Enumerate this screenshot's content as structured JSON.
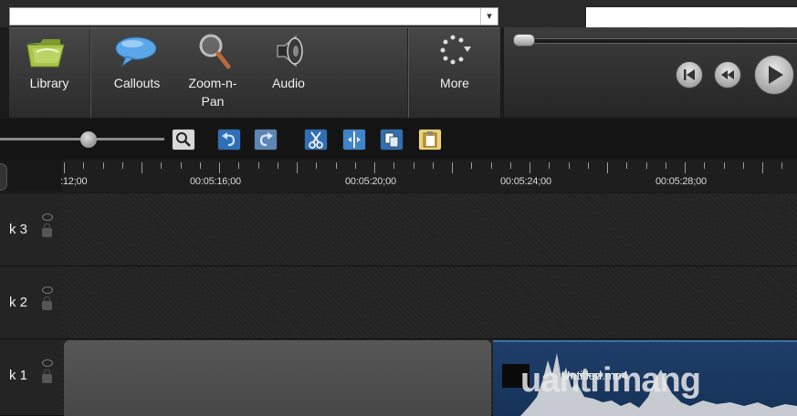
{
  "dropdown": {
    "value": ""
  },
  "toolbar": {
    "library": "Library",
    "callouts": "Callouts",
    "zoom_pan_line1": "Zoom-n-",
    "zoom_pan_line2": "Pan",
    "audio": "Audio",
    "more": "More"
  },
  "ruler": {
    "labels": [
      ":12;00",
      "00:05:16;00",
      "00:05:20;00",
      "00:05:24;00",
      "00:05:28;00"
    ]
  },
  "tracks": [
    {
      "label": "k 3"
    },
    {
      "label": "k 2"
    },
    {
      "label": "k 1"
    }
  ],
  "clip": {
    "name": "Untitled.mp4"
  },
  "watermark": {
    "text": "uantrimang"
  },
  "colors": {
    "clip_blue": "#1e3e6a",
    "toolbar": "#3a3a3a"
  }
}
